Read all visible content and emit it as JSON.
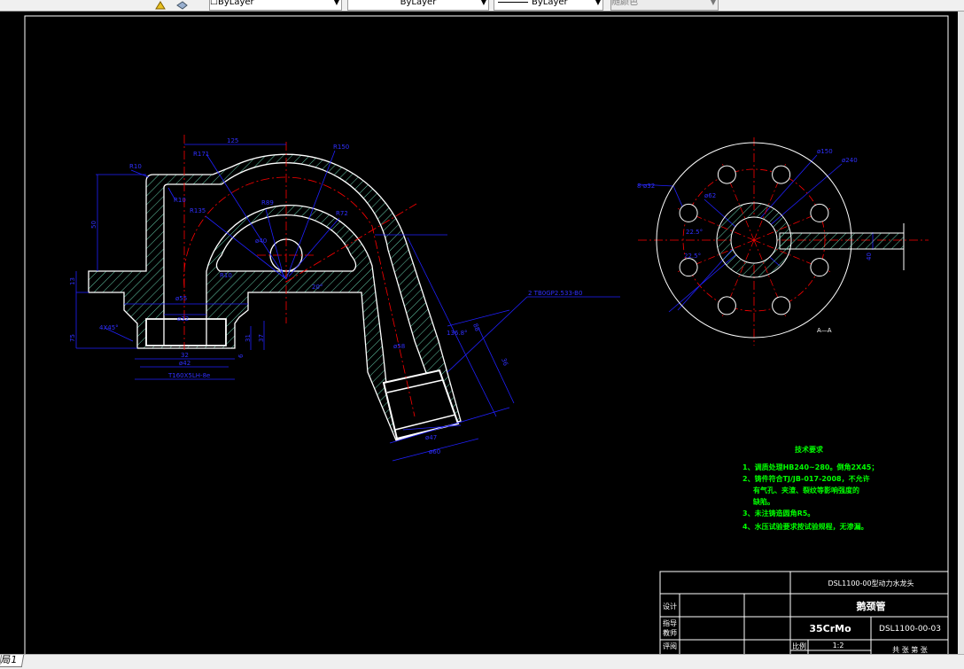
{
  "toolbar": {
    "color_select": "ByLayer",
    "linetype_select": "ByLayer",
    "lineweight_select": "ByLayer",
    "plotstyle_select": "随颜色"
  },
  "layout_tab": "局1",
  "colors": {
    "background": "#000000",
    "outline": "#ffffff",
    "centerline": "#ff0000",
    "dimension": "#0000ff",
    "hatch": "#7fffd4",
    "notes": "#00ff00"
  },
  "drawing": {
    "labels": [
      "125",
      "R10",
      "R171",
      "R150",
      "R10",
      "R135",
      "R89",
      "R72",
      "ø40",
      "R10",
      "20°",
      "ø55",
      "ø32",
      "4X45°",
      "32",
      "ø42",
      "T160X5LH-8e",
      "50",
      "13",
      "75",
      "31",
      "37",
      "6",
      "136.8°",
      "ø58",
      "ø47",
      "ø60",
      "88",
      "36",
      "2   TB0GP2.533-B0",
      "8-ø32",
      "ø150",
      "ø240",
      "ø62",
      "22.5°",
      "22.5°",
      "40",
      "A—A"
    ]
  },
  "tech_requirements": {
    "title": "技术要求",
    "items": [
      "1、调质处理HB240~280。倒角2X45；",
      "2、铸件符合TJ/JB-017-2008，不允许",
      "有气孔、夹渣、裂纹等影响强度的",
      "缺陷。",
      "3、未注铸造圆角R5。",
      "4、水压试验要求按试验规程，无渗漏。"
    ]
  },
  "title_block": {
    "project": "DSL1100-00型动力水龙头",
    "designer_label": "设计",
    "part_name": "鹅颈管",
    "advisor_label_1": "指导",
    "advisor_label_2": "教师",
    "material": "35CrMo",
    "drawing_number": "DSL1100-00-03",
    "reviewer_label": "评阅",
    "scale_label": "比例",
    "scale": "1:2",
    "sheets": "共 张 第 张"
  }
}
